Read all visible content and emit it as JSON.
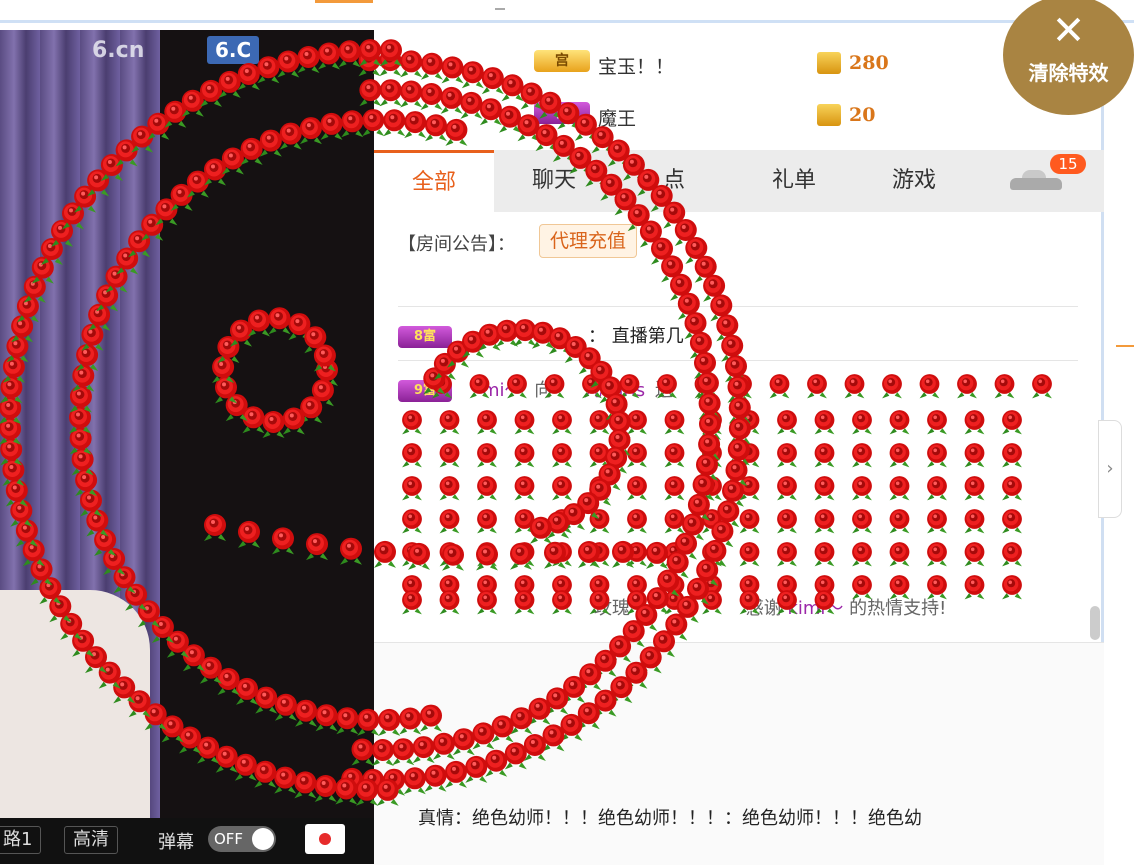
{
  "video": {
    "logo_text": "6.cn",
    "logo_badge": "6.C",
    "controls": {
      "line_label": "路1",
      "quality_label": "高清",
      "danmaku_label": "弹幕",
      "danmaku_toggle": "OFF"
    }
  },
  "ranking": [
    {
      "badge": "宫",
      "name": "宝玉！！",
      "score": "280"
    },
    {
      "badge": "宫",
      "name": "魔王",
      "score": "20"
    }
  ],
  "tabs": [
    {
      "label": "全部",
      "active": true
    },
    {
      "label": "聊天",
      "active": false
    },
    {
      "label": "点",
      "active": false
    },
    {
      "label": "礼单",
      "active": false
    },
    {
      "label": "游戏",
      "active": false
    }
  ],
  "car_badge": "15",
  "notice": {
    "label": "【房间公告】：",
    "link": "代理充值"
  },
  "messages": {
    "m1": {
      "badge": "8富",
      "text": "：  直播第几"
    },
    "m2": {
      "badge": "9富",
      "user": "mi～",
      "action": "向",
      "target": "儿chris",
      "verb": "送"
    },
    "m3": {
      "gift": "玫瑰",
      "thanks": "感谢",
      "user": "kimi～",
      "tail": "的热情支持!"
    }
  },
  "marquee": "真情：绝色幼师！！！绝色幼师！！！：绝色幼师！！！绝色幼",
  "clear_effects": {
    "label": "清除特效",
    "icon": "close-icon"
  },
  "colors": {
    "accent": "#e8601c",
    "rose": "#e01515",
    "clear_button": "#a98442"
  }
}
